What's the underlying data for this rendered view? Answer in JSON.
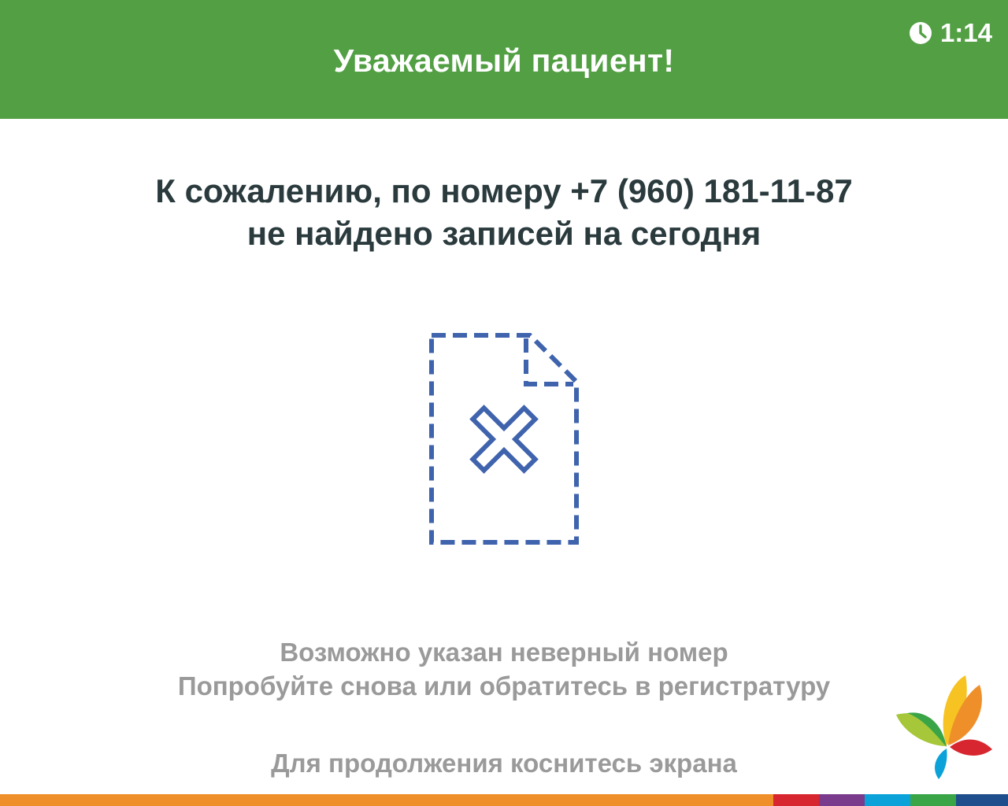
{
  "header": {
    "title": "Уважаемый пациент!",
    "timer": "1:14",
    "timer_icon": "clock-icon",
    "background": "#529f44"
  },
  "message": {
    "line1": "К сожалению, по номеру +7 (960) 181-11-87",
    "line2": "не найдено записей на сегодня"
  },
  "illustration": {
    "icon": "document-not-found-icon",
    "color": "#3f63ad"
  },
  "hint": {
    "line1": "Возможно указан неверный номер",
    "line2": "Попробуйте снова или обратитесь в регистратуру"
  },
  "touch_hint": "Для продолжения коснитесь экрана",
  "logo": {
    "icon": "butterfly-logo-icon"
  },
  "bottom_bar_colors": [
    "#ef8f2a",
    "#d7262f",
    "#7a3b8c",
    "#0aa2d8",
    "#3aa547",
    "#1f4e8c"
  ]
}
